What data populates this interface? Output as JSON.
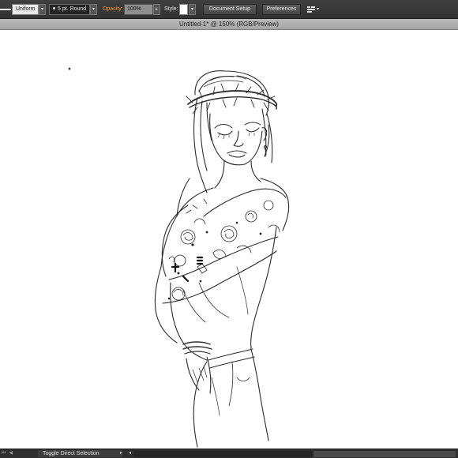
{
  "control_bar": {
    "stroke_profile": "Uniform",
    "brush": "5 pt. Round",
    "opacity_label": "Opacity:",
    "opacity_value": "100%",
    "style_label": "Style:",
    "document_setup": "Document Setup",
    "preferences": "Preferences",
    "icons": [
      "stroke-weight-icon",
      "dropdown-arrow-icon",
      "arrange-documents-icon"
    ]
  },
  "document": {
    "tab_title": "Untitled-1* @ 150% (RGB/Preview)"
  },
  "status_bar": {
    "nav_icons": [
      "first-artboard-icon",
      "previous-artboard-icon"
    ],
    "tool_status": "Toggle Direct Selection"
  }
}
